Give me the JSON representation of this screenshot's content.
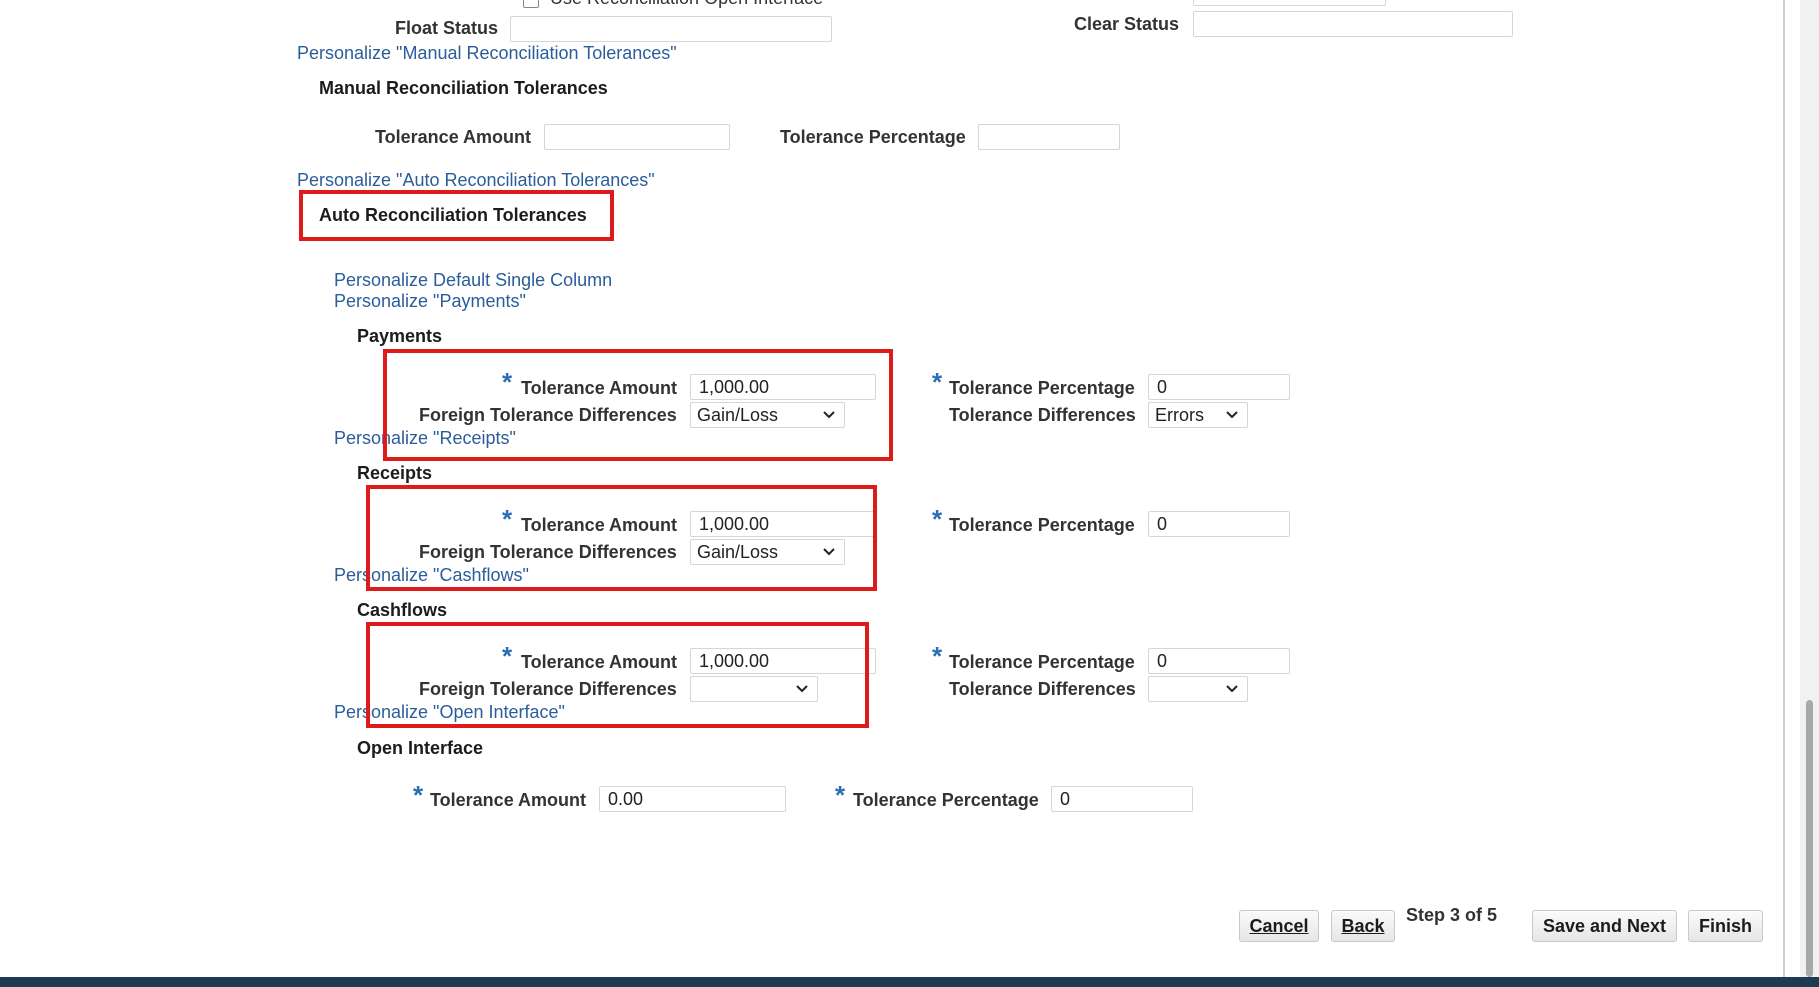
{
  "top": {
    "cut_checkbox_label": "Use Reconciliation Open Interface",
    "float_status_label": "Float Status",
    "float_status_value": "",
    "clear_status_label": "Clear Status",
    "clear_status_value": ""
  },
  "manual": {
    "personalize": "Personalize \"Manual Reconciliation Tolerances\"",
    "header": "Manual Reconciliation Tolerances",
    "tolerance_amount_label": "Tolerance Amount",
    "tolerance_amount_value": "",
    "tolerance_percentage_label": "Tolerance Percentage",
    "tolerance_percentage_value": ""
  },
  "auto": {
    "personalize": "Personalize \"Auto Reconciliation Tolerances\"",
    "header": "Auto Reconciliation Tolerances",
    "personalize_default": "Personalize Default Single Column",
    "personalize_payments": "Personalize \"Payments\""
  },
  "payments": {
    "header": "Payments",
    "required_mark": "*",
    "tolerance_amount_label": "Tolerance Amount",
    "tolerance_amount_value": "1,000.00",
    "foreign_diff_label": "Foreign Tolerance Differences",
    "foreign_diff_value": "Gain/Loss",
    "tolerance_percentage_label": "Tolerance Percentage",
    "tolerance_percentage_value": "0",
    "tolerance_diff_label": "Tolerance Differences",
    "tolerance_diff_value": "Errors",
    "personalize_next": "Personalize \"Receipts\""
  },
  "receipts": {
    "header": "Receipts",
    "required_mark": "*",
    "tolerance_amount_label": "Tolerance Amount",
    "tolerance_amount_value": "1,000.00",
    "foreign_diff_label": "Foreign Tolerance Differences",
    "foreign_diff_value": "Gain/Loss",
    "tolerance_percentage_label": "Tolerance Percentage",
    "tolerance_percentage_value": "0",
    "personalize_next": "Personalize \"Cashflows\""
  },
  "cashflows": {
    "header": "Cashflows",
    "required_mark": "*",
    "tolerance_amount_label": "Tolerance Amount",
    "tolerance_amount_value": "1,000.00",
    "foreign_diff_label": "Foreign Tolerance Differences",
    "foreign_diff_value": "",
    "tolerance_percentage_label": "Tolerance Percentage",
    "tolerance_percentage_value": "0",
    "tolerance_diff_label": "Tolerance Differences",
    "tolerance_diff_value": "",
    "personalize_next": "Personalize \"Open Interface\""
  },
  "open_interface": {
    "header": "Open Interface",
    "required_mark": "*",
    "tolerance_amount_label": "Tolerance Amount",
    "tolerance_amount_value": "0.00",
    "tolerance_percentage_label": "Tolerance Percentage",
    "tolerance_percentage_value": "0"
  },
  "footer": {
    "cancel": "Cancel",
    "back": "Back",
    "step": "Step 3 of 5",
    "save_next": "Save and Next",
    "finish": "Finish"
  },
  "colors": {
    "link": "#2a5d9a",
    "required": "#2a6fb5",
    "highlight": "#dd1b1b",
    "bottom_bar": "#1e3b52"
  },
  "icons": [
    "chevron-down-icon",
    "checkbox-icon"
  ]
}
